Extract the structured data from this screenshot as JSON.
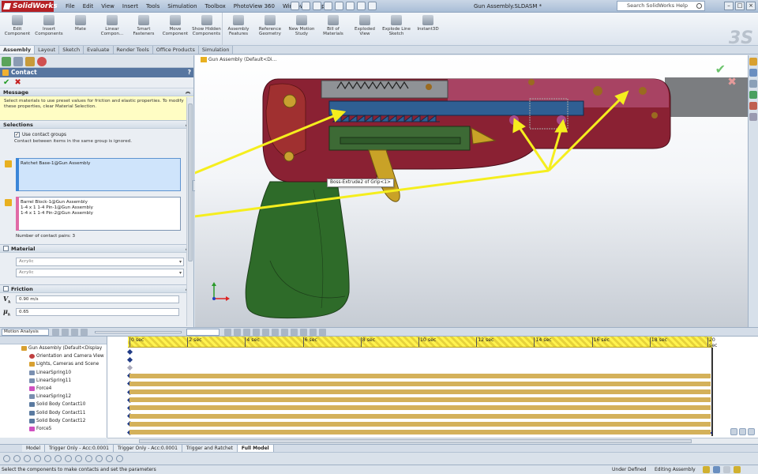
{
  "app": {
    "brand": "SolidWorks",
    "doc_title": "Gun Assembly.SLDASM *",
    "search_placeholder": "Search SolidWorks Help"
  },
  "menus": [
    "File",
    "Edit",
    "View",
    "Insert",
    "Tools",
    "Simulation",
    "Toolbox",
    "PhotoView 360",
    "Window",
    "Help"
  ],
  "ribbon": {
    "buttons": [
      {
        "label": "Edit Component",
        "icon": "edit-component-icon"
      },
      {
        "label": "Insert Components",
        "icon": "insert-components-icon"
      },
      {
        "label": "Mate",
        "icon": "mate-icon"
      },
      {
        "label": "Linear Compon...",
        "icon": "linear-pattern-icon"
      },
      {
        "label": "Smart Fasteners",
        "icon": "smart-fasteners-icon"
      },
      {
        "label": "Move Component",
        "icon": "move-component-icon"
      },
      {
        "label": "Show Hidden Components",
        "icon": "show-hidden-icon"
      },
      {
        "label": "Assembly Features",
        "icon": "assembly-features-icon"
      },
      {
        "label": "Reference Geometry",
        "icon": "reference-geometry-icon"
      },
      {
        "label": "New Motion Study",
        "icon": "motion-study-icon"
      },
      {
        "label": "Bill of Materials",
        "icon": "bom-icon"
      },
      {
        "label": "Exploded View",
        "icon": "exploded-view-icon"
      },
      {
        "label": "Explode Line Sketch",
        "icon": "explode-line-icon"
      },
      {
        "label": "Instant3D",
        "icon": "instant3d-icon"
      }
    ]
  },
  "tabs": [
    "Assembly",
    "Layout",
    "Sketch",
    "Evaluate",
    "Render Tools",
    "Office Products",
    "Simulation"
  ],
  "active_tab": "Assembly",
  "property_manager": {
    "title": "Contact",
    "message_header": "Message",
    "message": "Select materials to use preset values for friction and elastic properties. To modify these properties, clear Material Selection.",
    "selections_header": "Selections",
    "use_contact_groups": "Use contact groups",
    "groups_note": "Contact between items in the same group is ignored.",
    "group1": [
      "Ratchet Base-1@Gun Assembly"
    ],
    "group2": [
      "Barrel Block-1@Gun Assembly",
      "1-4 x 1 1-4 Pin-1@Gun Assembly",
      "1-4 x 1 1-4 Pin-2@Gun Assembly"
    ],
    "pairs": "Number of contact pairs: 3",
    "material_header": "Material",
    "material1": "Acrylic",
    "material2": "Acrylic",
    "friction_header": "Friction",
    "friction_vk_label": "V",
    "friction_vk_sub": "k",
    "friction_vk": "0.90 m/s",
    "friction_mu_label": "μ",
    "friction_mu_sub": "k",
    "friction_mu": "0.65"
  },
  "viewport": {
    "tree_label": "Gun Assembly  (Default<Di...",
    "hover_label": "Boss-Extrude2 of Grip<1>"
  },
  "motion": {
    "study_type": "Motion Analysis",
    "time_labels": [
      "0 sec",
      "2 sec",
      "4 sec",
      "6 sec",
      "8 sec",
      "10 sec",
      "12 sec",
      "14 sec",
      "16 sec",
      "18 sec",
      "20 sec"
    ],
    "tree": [
      "Gun Assembly  (Default<Display",
      "Orientation and Camera View",
      "Lights, Cameras and Scene",
      "LinearSpring10",
      "LinearSpring11",
      "Force4",
      "LinearSpring12",
      "Solid Body Contact10",
      "Solid Body Contact11",
      "Solid Body Contact12",
      "Force5"
    ]
  },
  "sheet_tabs": [
    "Model",
    "Trigger Only - Acc:0.0001",
    "Trigger Only - Acc:0.0001",
    "Trigger and Ratchet",
    "Full Model"
  ],
  "active_sheet": "Full Model",
  "status": {
    "left": "Select the components to make contacts and set the parameters",
    "right1": "Under Defined",
    "right2": "Editing Assembly"
  }
}
